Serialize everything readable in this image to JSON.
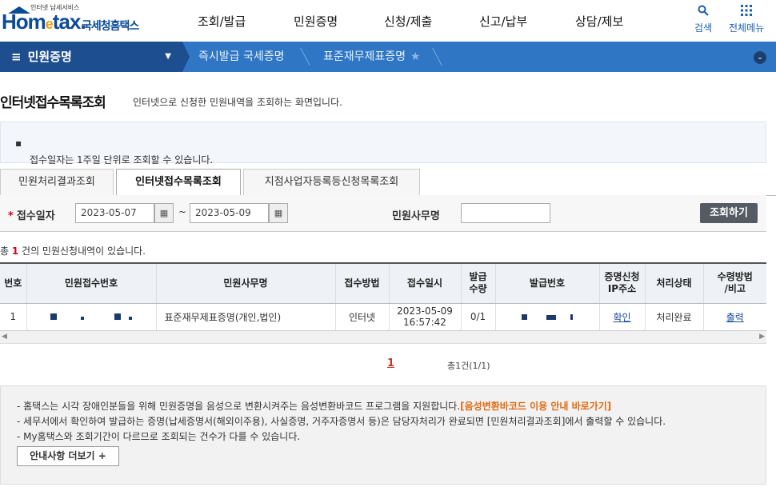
{
  "header": {
    "logo_small": "인터넷 납세서비스",
    "logo_brand": "Home tax",
    "logo_kr": "국세청홈택스",
    "nav": [
      "조회/발급",
      "민원증명",
      "신청/제출",
      "신고/납부",
      "상담/제보"
    ],
    "search_label": "검색",
    "menu_label": "전체메뉴"
  },
  "location": {
    "first": "민원증명",
    "crumbs": [
      "즉시발급 국세증명",
      "표준재무제표증명"
    ]
  },
  "page": {
    "title": "인터넷접수목록조회",
    "description": "인터넷으로 신청한 민원내역을 조회하는 화면입니다.",
    "info": "접수일자는 1주일 단위로 조회할 수 있습니다."
  },
  "tabs": [
    {
      "label": "민원처리결과조회",
      "active": false
    },
    {
      "label": "인터넷접수목록조회",
      "active": true
    },
    {
      "label": "지점사업자등록등신청목록조회",
      "active": false
    }
  ],
  "search": {
    "date_label": "접수일자",
    "date_from": "2023-05-07",
    "date_sep": "~",
    "date_to": "2023-05-09",
    "office_label": "민원사무명",
    "office_value": "",
    "submit_label": "조회하기"
  },
  "result": {
    "prefix": "총 ",
    "count": "1",
    "suffix": " 건의 민원신청내역이 있습니다."
  },
  "table": {
    "headers": [
      "번호",
      "민원접수번호",
      "민원사무명",
      "접수방법",
      "접수일시",
      "발급\n수량",
      "발급번호",
      "증명신청\nIP주소",
      "처리상태",
      "수령방법\n/비고"
    ],
    "rows": [
      {
        "no": "1",
        "office": "표준재무제표증명(개인,법인)",
        "method": "인터넷",
        "date": "2023-05-09",
        "time": "16:57:42",
        "qty": "0/1",
        "ip_link": "확인",
        "status": "처리완료",
        "receive_link": "출력"
      }
    ]
  },
  "pagination": {
    "current": "1",
    "summary": "총1건(1/1)"
  },
  "notice": {
    "line1": "- 홈택스는 시각 장애인분들을 위해 민원증명을 음성으로 변환시켜주는 음성변환바코드 프로그램을 지원합니다.",
    "line1_link": "[음성변환바코드 이용 안내 바로가기]",
    "line2": "- 세무서에서 확인하여 발급하는 증명(납세증명서(해외이주용), 사실증명, 거주자증명서 등)은 담당자처리가 완료되면 [민원처리결과조회]에서 출력할 수 있습니다.",
    "line3": "- My홈택스와 조회기간이 다르므로 조회되는 건수가 다를 수 있습니다.",
    "more_label": "안내사항 더보기 +"
  }
}
